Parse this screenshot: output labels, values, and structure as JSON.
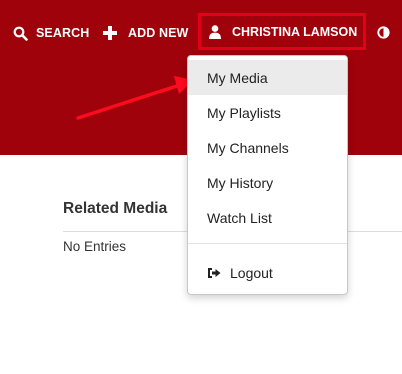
{
  "header": {
    "search_label": "SEARCH",
    "add_new_label": "ADD NEW",
    "user_label": "CHRISTINA LAMSON",
    "background_color": "#a0020b",
    "highlight_color": "#e3001a"
  },
  "user_menu": {
    "items": [
      {
        "label": "My Media",
        "active": true
      },
      {
        "label": "My Playlists"
      },
      {
        "label": "My Channels"
      },
      {
        "label": "My History"
      },
      {
        "label": "Watch List"
      }
    ],
    "logout_label": "Logout"
  },
  "related": {
    "title": "Related Media",
    "empty_text": "No Entries"
  },
  "icons": {
    "search": "search-icon",
    "add": "plus-icon",
    "user": "user-icon",
    "contrast": "contrast-icon",
    "logout": "sign-out-icon",
    "annotation": "red-arrow"
  }
}
